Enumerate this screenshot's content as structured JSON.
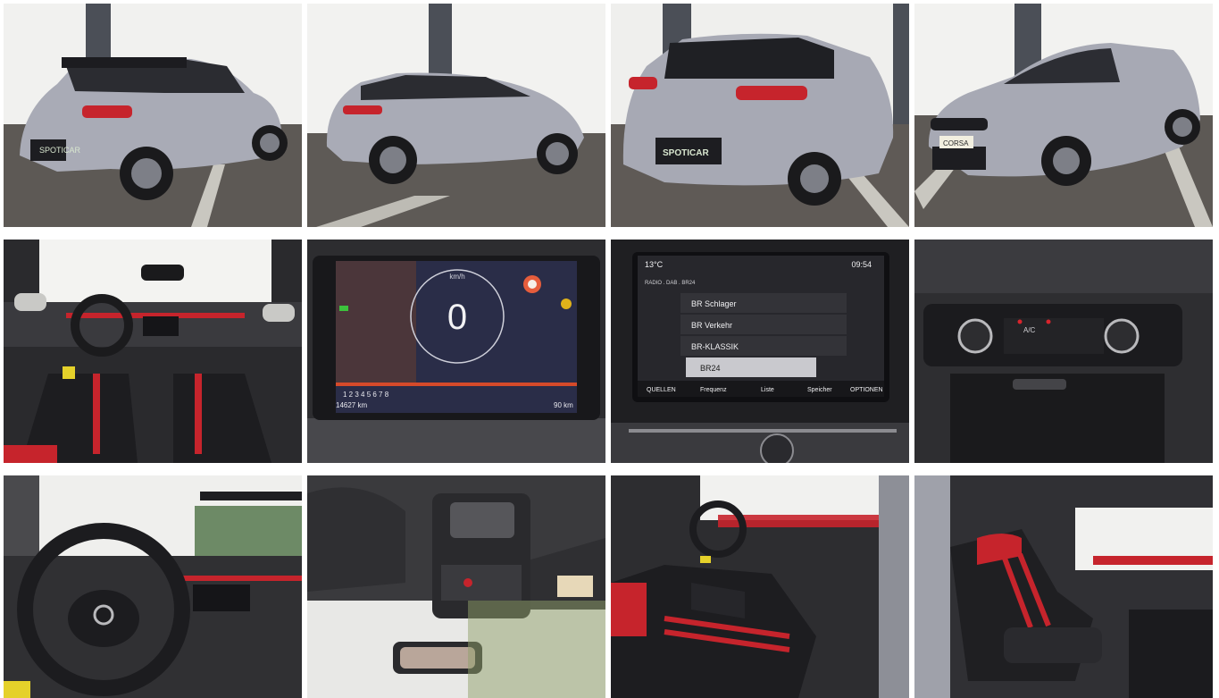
{
  "gallery": {
    "photos": [
      {
        "subject": "rear three-quarter left"
      },
      {
        "subject": "side rear left"
      },
      {
        "subject": "rear"
      },
      {
        "subject": "front three-quarter"
      },
      {
        "subject": "interior dashboard overview"
      },
      {
        "subject": "instrument cluster"
      },
      {
        "subject": "infotainment radio screen"
      },
      {
        "subject": "climate control panel"
      },
      {
        "subject": "steering wheel and dashboard"
      },
      {
        "subject": "overhead console and mirror"
      },
      {
        "subject": "front seats from driver door"
      },
      {
        "subject": "front seats from passenger side"
      }
    ]
  },
  "plates": {
    "rear": "SPOTICAR",
    "front": "CORSA"
  },
  "cluster": {
    "speed_unit": "km/h",
    "speed": "0",
    "gears": "1 2 3 4 5 6 7 8",
    "odometer": "14627 km",
    "range": "90 km"
  },
  "radio": {
    "temperature": "13°C",
    "time": "09:54",
    "source_line": "RADIO . DAB . BR24",
    "stations": [
      "BR Schlager",
      "BR Verkehr",
      "BR-KLASSIK",
      "BR24"
    ],
    "tabs": [
      "QUELLEN",
      "Frequenz",
      "Liste",
      "Speicher",
      "OPTIONEN"
    ]
  },
  "climate": {
    "ac_label": "A/C"
  },
  "colors": {
    "car_silver": "#a7a9b4",
    "roof_black": "#1e1e22",
    "accent_red": "#d8242c",
    "asphalt": "#5f5a56",
    "wall": "#f2f2f0"
  }
}
